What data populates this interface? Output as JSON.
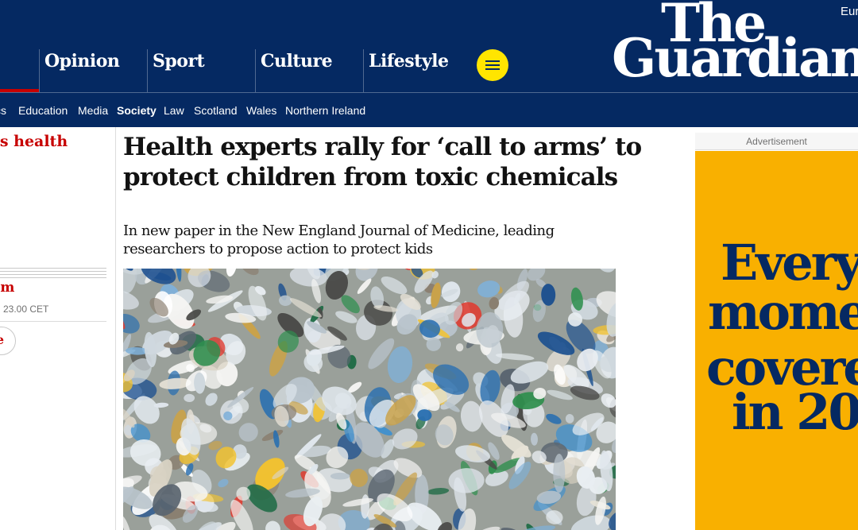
{
  "masthead": {
    "edition": "Eur",
    "logo_line1": "The",
    "logo_line2": "Guardian",
    "pillars": [
      "Opinion",
      "Sport",
      "Culture",
      "Lifestyle"
    ],
    "subnav": [
      "cs",
      "Education",
      "Media",
      "Society",
      "Law",
      "Scotland",
      "Wales",
      "Northern Ireland"
    ],
    "subnav_active": "Society",
    "brand_color": "#052962",
    "menu_color": "#ffe500"
  },
  "left_column": {
    "series_title": "'s health",
    "sub_heading": "um",
    "timestamp": "23.00 CET",
    "button_label": "e"
  },
  "article": {
    "headline": "Health experts rally for ‘call to arms’ to protect children from toxic chemicals",
    "standfirst": "In new paper in the New England Journal of Medicine, leading researchers to propose action to protect kids"
  },
  "advert": {
    "label": "Advertisement",
    "lines": [
      "Every",
      "mome",
      "covere",
      "in 20"
    ],
    "background": "#f9b000"
  }
}
